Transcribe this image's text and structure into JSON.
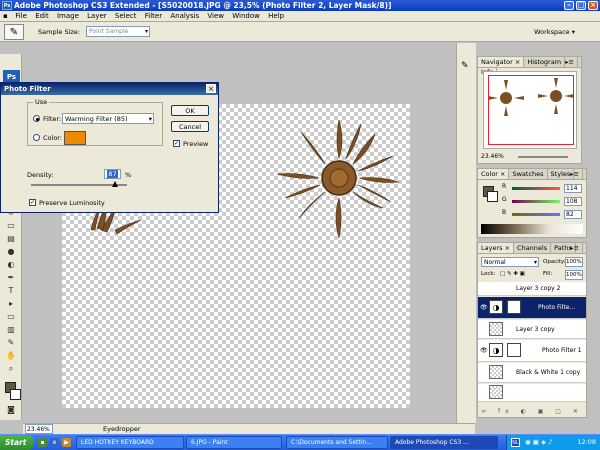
{
  "app": {
    "title": "Adobe Photoshop CS3 Extended - [S5020018.JPG @ 23,5% (Photo Filter 2, Layer Mask/8)]",
    "logo": "Ps"
  },
  "menu": [
    "File",
    "Edit",
    "Image",
    "Layer",
    "Select",
    "Filter",
    "Analysis",
    "View",
    "Window",
    "Help"
  ],
  "options": {
    "sample_label": "Sample Size:",
    "sample_value": "Point Sample",
    "workspace": "Workspace ▾"
  },
  "statusbar": {
    "zoom": "23.46%",
    "editor": "Eyedropper"
  },
  "dialog": {
    "title": "Photo Filter",
    "use_label": "Use",
    "filter_label": "Filter:",
    "filter_value": "Warming Filter (85)",
    "color_label": "Color:",
    "color_swatch": "#ec8a00",
    "density_label": "Density:",
    "density_value": "87",
    "density_unit": "%",
    "density_fraction": 0.87,
    "preserve_label": "Preserve Luminosity",
    "preserve_checked": true,
    "ok": "OK",
    "cancel": "Cancel",
    "preview_label": "Preview",
    "preview_checked": true
  },
  "navigator": {
    "tabs": [
      "Navigator ×",
      "Histogram",
      "Info"
    ],
    "zoom": "23.46%"
  },
  "color": {
    "tabs": [
      "Color ×",
      "Swatches",
      "Styles"
    ],
    "r_label": "R",
    "g_label": "G",
    "b_label": "B",
    "r": "114",
    "g": "108",
    "b": "82",
    "foreground": "#575b45"
  },
  "layers": {
    "tabs": [
      "Layers ×",
      "Channels",
      "Paths"
    ],
    "blend": "Normal",
    "opacity_label": "Opacity:",
    "opacity": "100%",
    "lock_label": "Lock:",
    "fill_label": "Fill:",
    "fill": "100%",
    "items": [
      {
        "name": "Layer 3 copy 2"
      },
      {
        "name": "Photo Filte..."
      },
      {
        "name": "Layer 3 copy"
      },
      {
        "name": "Photo Filter 1"
      },
      {
        "name": "Black & White 1 copy"
      }
    ]
  },
  "taskbar": {
    "start": "Start",
    "tasks": [
      "LED HOTKEY KEYBOARD",
      "6.JPG - Paint",
      "C:\\Documents and Settin...",
      "Adobe Photoshop CS3 ..."
    ],
    "lang": "NL",
    "clock": "12:08"
  }
}
